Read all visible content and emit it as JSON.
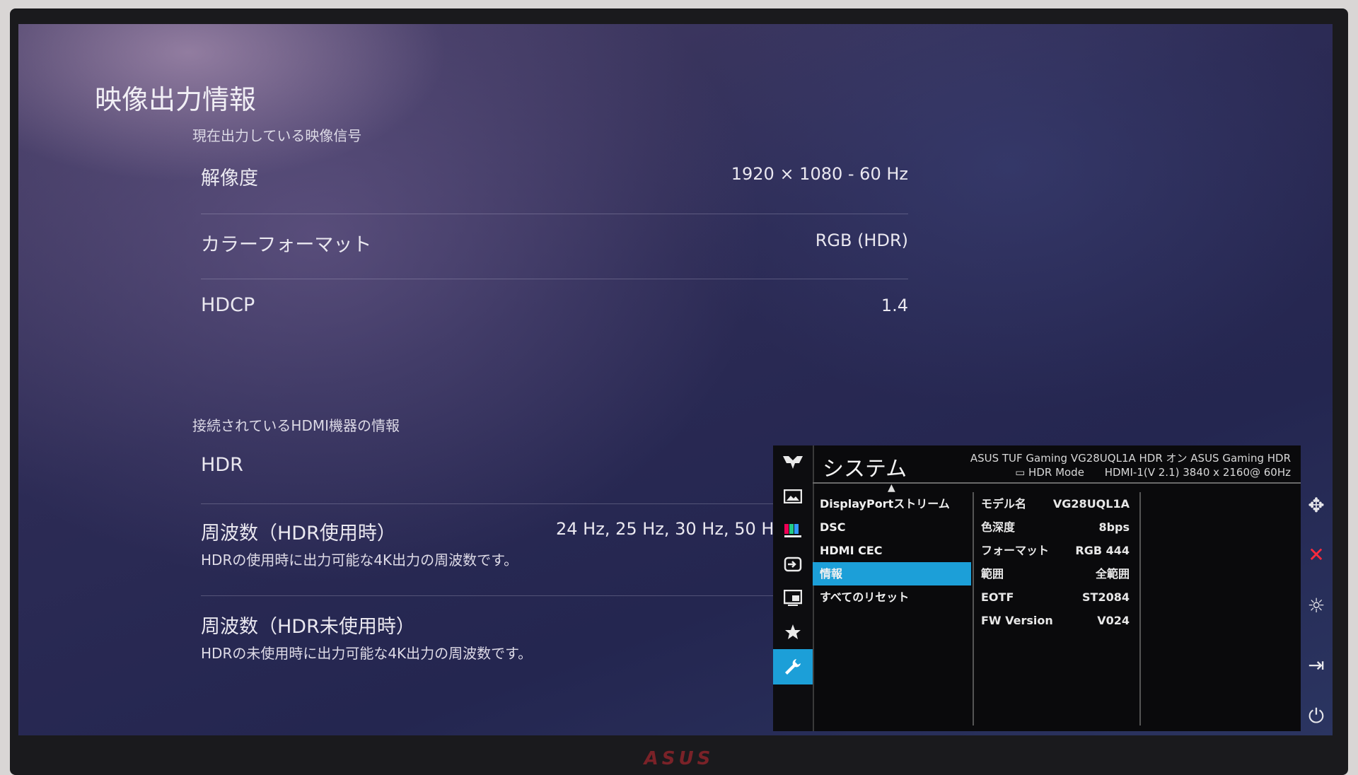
{
  "ps": {
    "title": "映像出力情報",
    "section1": "現在出力している映像信号",
    "rows1": [
      {
        "label": "解像度",
        "value": "1920 × 1080 - 60 Hz"
      },
      {
        "label": "カラーフォーマット",
        "value": "RGB (HDR)"
      },
      {
        "label": "HDCP",
        "value": "1.4"
      }
    ],
    "section2": "接続されているHDMI機器の情報",
    "rows2": [
      {
        "label": "HDR",
        "value": "",
        "sub": ""
      },
      {
        "label": "周波数（HDR使用時）",
        "value": "24 Hz, 25 Hz, 30 Hz, 50 H",
        "sub": "HDRの使用時に出力可能な4K出力の周波数です。"
      },
      {
        "label": "周波数（HDR未使用時）",
        "value": "",
        "sub": "HDRの未使用時に出力可能な4K出力の周波数です。"
      }
    ]
  },
  "osd": {
    "title": "システム",
    "status_line1": "ASUS TUF Gaming  VG28UQL1A  HDR オン   ASUS Gaming HDR",
    "status_line2_mode": "HDR Mode",
    "status_line2": "HDMI-1(V 2.1)  3840 x 2160@  60Hz",
    "menu": [
      "DisplayPortストリーム",
      "DSC",
      "HDMI CEC",
      "情報",
      "すべてのリセット"
    ],
    "active_menu_index": 3,
    "info": [
      {
        "k": "モデル名",
        "v": "VG28UQL1A"
      },
      {
        "k": "色深度",
        "v": "8bps"
      },
      {
        "k": "フォーマット",
        "v": "RGB 444"
      },
      {
        "k": "範囲",
        "v": "全範囲"
      },
      {
        "k": "EOTF",
        "v": "ST2084"
      },
      {
        "k": "FW Version",
        "v": "V024"
      }
    ],
    "side_icons": [
      "tuf-logo-icon",
      "image-icon",
      "color-icon",
      "input-icon",
      "pip-icon",
      "favorite-star-icon",
      "wrench-icon"
    ],
    "active_side_icon": "wrench-icon"
  },
  "keys": [
    "navigation-joystick-icon",
    "close-icon",
    "gamevisual-icon",
    "input-select-icon",
    "power-icon"
  ],
  "colors": {
    "accent": "#1c9fd8",
    "close": "#ff2a3c",
    "brand": "#7a2228"
  },
  "brand": "ASUS"
}
